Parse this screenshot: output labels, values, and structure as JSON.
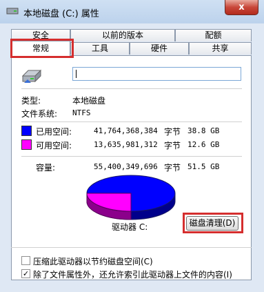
{
  "window": {
    "title": "本地磁盘 (C:) 属性",
    "close_label": "x"
  },
  "tabs": {
    "top_row": [
      "安全",
      "以前的版本",
      "配额"
    ],
    "bottom_row": [
      "常规",
      "工具",
      "硬件",
      "共享"
    ],
    "active": "常规"
  },
  "general": {
    "name_value": "",
    "type_label": "类型:",
    "type_value": "本地磁盘",
    "fs_label": "文件系统:",
    "fs_value": "NTFS",
    "used": {
      "label": "已用空间:",
      "bytes": "41,764,368,384",
      "unit": "字节",
      "gb": "38.8 GB",
      "color": "#0000ff"
    },
    "free": {
      "label": "可用空间:",
      "bytes": "13,635,981,312",
      "unit": "字节",
      "gb": "12.6 GB",
      "color": "#ff00ff"
    },
    "capacity": {
      "label": "容量:",
      "bytes": "55,400,349,696",
      "unit": "字节",
      "gb": "51.5 GB"
    },
    "drive_label": "驱动器 C:",
    "cleanup_button": "磁盘清理(D)",
    "compress_checkbox": {
      "label": "压缩此驱动器以节约磁盘空间(C)",
      "checked": false
    },
    "index_checkbox": {
      "label": "除了文件属性外，还允许索引此驱动器上文件的内容(I)",
      "checked": true
    }
  },
  "icons": {
    "title": "drive-icon",
    "drive": "hard-drive-icon"
  }
}
